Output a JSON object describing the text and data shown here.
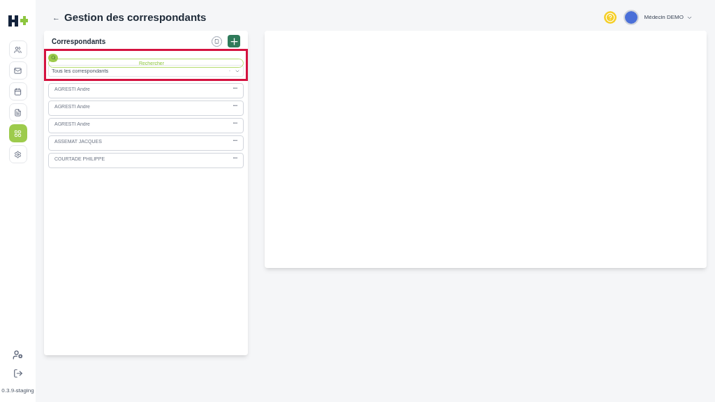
{
  "sidebar": {
    "items": [
      {
        "selected": false
      },
      {
        "selected": false
      },
      {
        "selected": false
      },
      {
        "selected": false
      },
      {
        "selected": true
      },
      {
        "selected": false
      }
    ],
    "version": "0.3.9-staging"
  },
  "header": {
    "back": "←",
    "title": "Gestion des correspondants",
    "user": "Médecin DEMO"
  },
  "panel": {
    "title": "Correspondants",
    "search": {
      "placeholder": "Rechercher"
    },
    "filter": {
      "value": "Tous les correspondants",
      "clear": "-"
    },
    "rows": [
      "AGRESTI Andre",
      "AGRESTI Andre",
      "AGRESTI Andre",
      "ASSEMAT JACQUES",
      "COURTADE PHILIPPE"
    ],
    "more": "•••"
  }
}
